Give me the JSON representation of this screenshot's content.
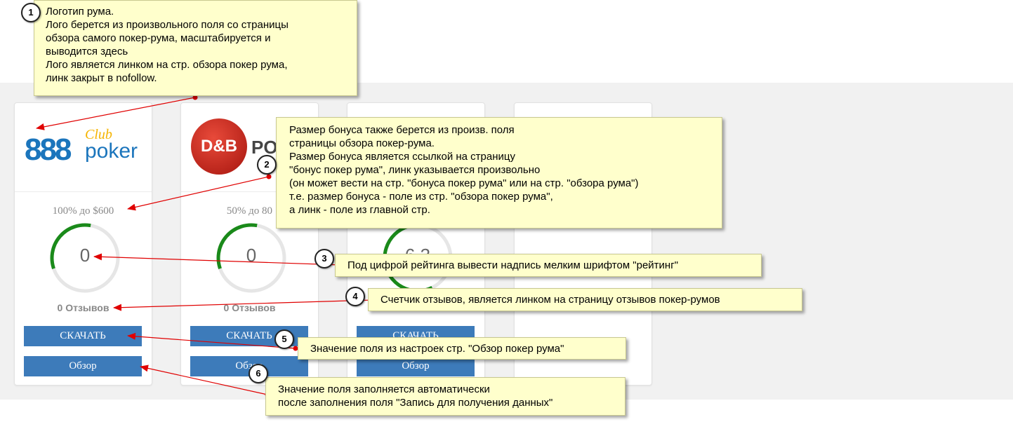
{
  "cards": [
    {
      "logo": {
        "number": "888",
        "club": "Club",
        "poker": "poker"
      },
      "bonus": "100% до $600",
      "score": "0",
      "rating_fraction": 0.33,
      "reviews": "0 Отзывов",
      "download_label": "СКАЧАТЬ",
      "review_label": "Обзор"
    },
    {
      "logo": {
        "badge_text": "D&B",
        "side_text": "PO"
      },
      "bonus": "50% до 80",
      "score": "0",
      "rating_fraction": 0.33,
      "reviews": "0 Отзывов",
      "download_label": "СКАЧАТЬ",
      "review_label": "Обзор"
    },
    {
      "logo": {},
      "bonus": "",
      "score": "6.3",
      "rating_fraction": 0.6,
      "reviews": "",
      "download_label": "СКАЧАТЬ",
      "review_label": "Обзор"
    },
    {
      "logo": {},
      "bonus": "",
      "score": "",
      "rating_fraction": 0,
      "reviews": "",
      "download_label": "",
      "review_label": ""
    }
  ],
  "notes": [
    {
      "number": "1",
      "lines": [
        "Логотип рума.",
        "Лого берется из произвольного поля со страницы",
        "обзора самого покер-рума, масштабируется и",
        "выводится здесь",
        "Лого является линком на стр. обзора покер рума,",
        "линк закрыт в nofollow."
      ]
    },
    {
      "number": "2",
      "lines": [
        "Размер бонуса также берется из произв. поля",
        "страницы обзора покер-рума.",
        "Размер бонуса является ссылкой на страницу",
        "\"бонус покер рума\", линк указывается произвольно",
        "(он может вести на стр. \"бонуса покер рума\" или на стр. \"обзора рума\")",
        "т.е. размер бонуса - поле из стр. \"обзора покер рума\",",
        "а линк - поле из главной стр."
      ]
    },
    {
      "number": "3",
      "lines": [
        "Под цифрой рейтинга вывести надпись мелким шрифтом \"рейтинг\""
      ]
    },
    {
      "number": "4",
      "lines": [
        "Счетчик отзывов, является линком на страницу отзывов покер-румов"
      ]
    },
    {
      "number": "5",
      "lines": [
        "Значение поля из настроек стр. \"Обзор покер рума\""
      ]
    },
    {
      "number": "6",
      "lines": [
        "Значение поля заполняется автоматически",
        "после заполнения поля \"Запись для получения данных\""
      ]
    }
  ],
  "colors": {
    "gauge_green": "#1a8a1a",
    "gauge_track": "#e6e6e6",
    "button_blue": "#3d7bba",
    "note_yellow": "#ffffcc",
    "arrow_red": "#e00000"
  }
}
